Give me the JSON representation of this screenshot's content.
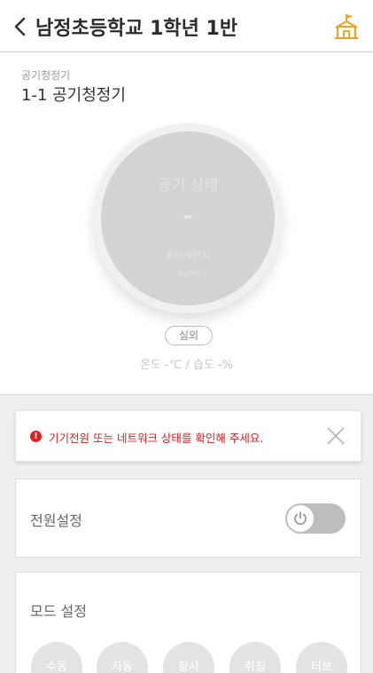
{
  "header": {
    "title": "남정초등학교 1학년 1반",
    "back_icon": "chevron-left-icon",
    "school_icon": "school-icon",
    "accent_color": "#f0a020"
  },
  "device": {
    "category": "공기청정기",
    "name": "1-1 공기청정기"
  },
  "status": {
    "label": "공기 상태",
    "value": "-",
    "sub_label": "초미세먼지",
    "unit_text": "-μg/㎥"
  },
  "outdoor": {
    "pill": "실외",
    "temp_humidity": "온도 -℃ / 습도 -%"
  },
  "alert": {
    "icon": "alert-icon",
    "message": "기기전원 또는 네트워크 상태를 확인해 주세요.",
    "color": "#d42020"
  },
  "power": {
    "label": "전원설정",
    "toggle_icon": "power-icon"
  },
  "mode": {
    "label": "모드 설정",
    "options": [
      "수동",
      "자동",
      "황사",
      "취침",
      "터보"
    ]
  }
}
